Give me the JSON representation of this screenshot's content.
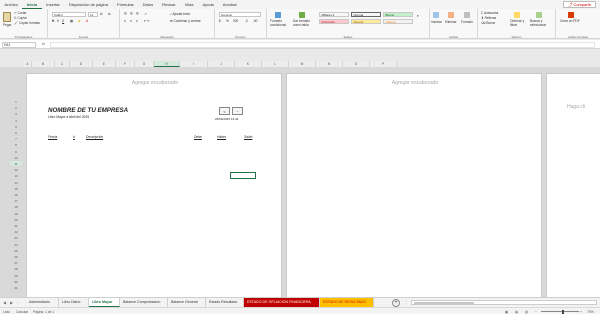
{
  "menu": {
    "items": [
      "Archivo",
      "Inicio",
      "Insertar",
      "Disposición de página",
      "Fórmulas",
      "Datos",
      "Revisar",
      "Vista",
      "Ayuda",
      "Acrobat"
    ],
    "active_index": 1,
    "share_label": "Compartir"
  },
  "ribbon": {
    "clipboard": {
      "paste": "Pegar",
      "cut": "Cortar",
      "copy": "Copiar",
      "format_painter": "Copiar formato",
      "label": "Portapapeles"
    },
    "font": {
      "name": "Calibri",
      "size": "11",
      "label": "Fuente"
    },
    "alignment": {
      "wrap": "Ajustar texto",
      "merge": "Combinar y centrar",
      "label": "Alineación"
    },
    "number": {
      "format": "General",
      "label": "Número"
    },
    "styles": {
      "conditional": "Formato condicional",
      "table_format": "Dar formato como tabla",
      "cells": [
        {
          "text": "Millares 2",
          "bg": "#ffffff",
          "fg": "#333333"
        },
        {
          "text": "Normal",
          "bg": "#ffffff",
          "fg": "#333333"
        },
        {
          "text": "Bueno",
          "bg": "#c6efce",
          "fg": "#006100"
        },
        {
          "text": "Incorrecto",
          "bg": "#ffc7ce",
          "fg": "#9c0006"
        },
        {
          "text": "Neutral",
          "bg": "#ffeb9c",
          "fg": "#9c5700"
        },
        {
          "text": "Cálculo",
          "bg": "#f2f2f2",
          "fg": "#fa7d00"
        }
      ],
      "label": "Estilos"
    },
    "cells": {
      "insert": "Insertar",
      "delete": "Eliminar",
      "format": "Formato",
      "label": "Celdas"
    },
    "editing": {
      "autosum": "Autosuma",
      "fill": "Rellenar",
      "clear": "Borrar",
      "sort": "Ordenar y filtrar",
      "find": "Buscar y seleccionar",
      "label": "Edición"
    },
    "acrobat": {
      "create_pdf": "Crear un PDF",
      "label": "Adobe Acrobat"
    }
  },
  "formula_bar": {
    "name_box": "H11",
    "fx": "fx",
    "value": ""
  },
  "columns": [
    "A",
    "B",
    "C",
    "D",
    "E",
    "F",
    "G",
    "H",
    "I",
    "J",
    "K",
    "L",
    "M",
    "N",
    "O",
    "P"
  ],
  "selected_column": "H",
  "rows": [
    "1",
    "2",
    "3",
    "4",
    "5",
    "6",
    "7",
    "8",
    "9",
    "10",
    "11",
    "12",
    "13",
    "14",
    "15",
    "16",
    "17",
    "18",
    "19",
    "20",
    "21",
    "22",
    "23",
    "24",
    "25",
    "26",
    "27",
    "28",
    "29",
    "30",
    "31"
  ],
  "selected_row": "11",
  "page": {
    "header_hint": "Agregar encabezado",
    "header_hint_right": "Haga cli",
    "company": "NOMBRE DE TU EMPRESA",
    "subtitle": "Libro Mayor a Abril del 2025",
    "nav_prev": "<",
    "nav_next": "...",
    "timestamp": "26/06/2025 13:44",
    "col_fecha": "Fecha",
    "col_num": "#",
    "col_desc": "Descripción",
    "col_debe": "Debe",
    "col_haber": "Haber",
    "col_saldo": "Saldo"
  },
  "tabs": [
    {
      "label": "Asientodiario",
      "bg": "",
      "fg": ""
    },
    {
      "label": "Libro Diario",
      "bg": "",
      "fg": ""
    },
    {
      "label": "Libro Mayor",
      "bg": "",
      "fg": "",
      "active": true
    },
    {
      "label": "Balance Comprobacion",
      "bg": "",
      "fg": ""
    },
    {
      "label": "Balance General",
      "bg": "",
      "fg": ""
    },
    {
      "label": "Estado Resultado",
      "bg": "",
      "fg": ""
    },
    {
      "label": "ESTADO DE SITUACION FINANCIERA",
      "bg": "#c00000",
      "fg": "#ffffff"
    },
    {
      "label": "ESTADO DE RESULTADO",
      "bg": "#ffc000",
      "fg": "#c00000"
    }
  ],
  "tab_more": "...",
  "status": {
    "ready": "Listo",
    "calculate": "Calcular",
    "page": "Página: 1 de 1",
    "zoom": "70%"
  }
}
